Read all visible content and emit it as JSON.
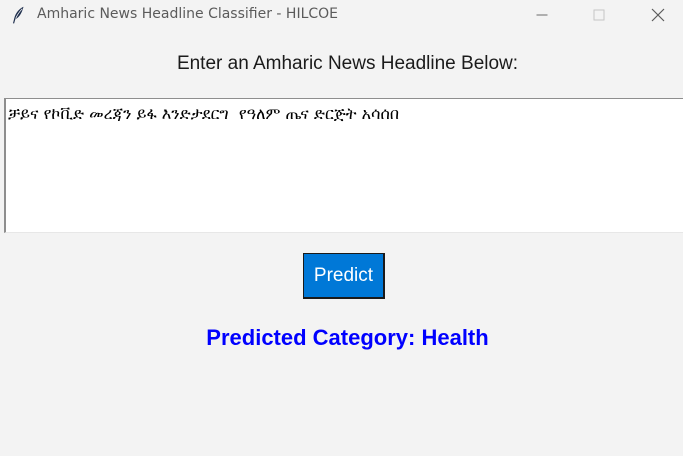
{
  "window": {
    "title": "Amharic News Headline Classifier - HILCOE",
    "app_icon": "feather-icon",
    "controls": [
      "minimize-icon",
      "maximize-icon",
      "close-icon"
    ]
  },
  "main": {
    "prompt_label": "Enter an Amharic News Headline Below:",
    "headline_text": "ቻይና የኮቪድ መረጃን ይፋ እንድታደርግ  የዓለም ጤና ድርጅት አሳሰበ",
    "predict_button_label": "Predict",
    "result_label": "Predicted Category: Health"
  },
  "colors": {
    "background": "#f3f3f3",
    "button": "#0078d7",
    "result_text": "#0000ff"
  }
}
